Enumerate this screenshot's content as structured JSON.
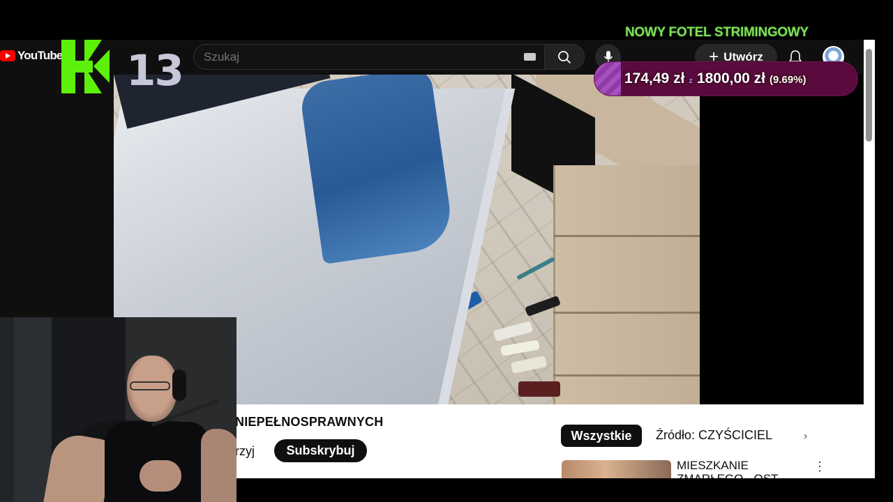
{
  "youtube_header": {
    "logo_text": "YouTube",
    "search_placeholder": "Szukaj",
    "create_label": "Utwórz",
    "icons": [
      "youtube-logo",
      "keyboard-icon",
      "search-icon",
      "microphone-icon",
      "plus-icon",
      "bell-icon",
      "avatar"
    ]
  },
  "stream_overlay": {
    "logo_number": "13",
    "goal_title": "NOWY FOTEL STRIMINGOWY",
    "donation_current": "174,49 zł",
    "donation_sep": "z",
    "donation_goal": "1800,00 zł",
    "donation_percent": "(9.69%)",
    "donation_progress": 0.0969
  },
  "video_info": {
    "channel_name": "NIEPEŁNOSPRAWNYCH",
    "join_text": "rzyj",
    "subscribe_label": "Subskrybuj"
  },
  "recommendations": {
    "chip_all": "Wszystkie",
    "chip_source": "Źródło: CZYŚCICIEL",
    "chip_next_icon": "chevron-right-icon",
    "first_title": "MIESZKANIE ZMARŁEGO - OST",
    "more_icon": "more-vert-icon"
  },
  "colors": {
    "accent_green": "#5cf00a",
    "goal_green": "#7fe05a",
    "donation_bg": "#5a0a3c",
    "donation_fill": "#a451bd",
    "yt_red": "#ff0000"
  }
}
